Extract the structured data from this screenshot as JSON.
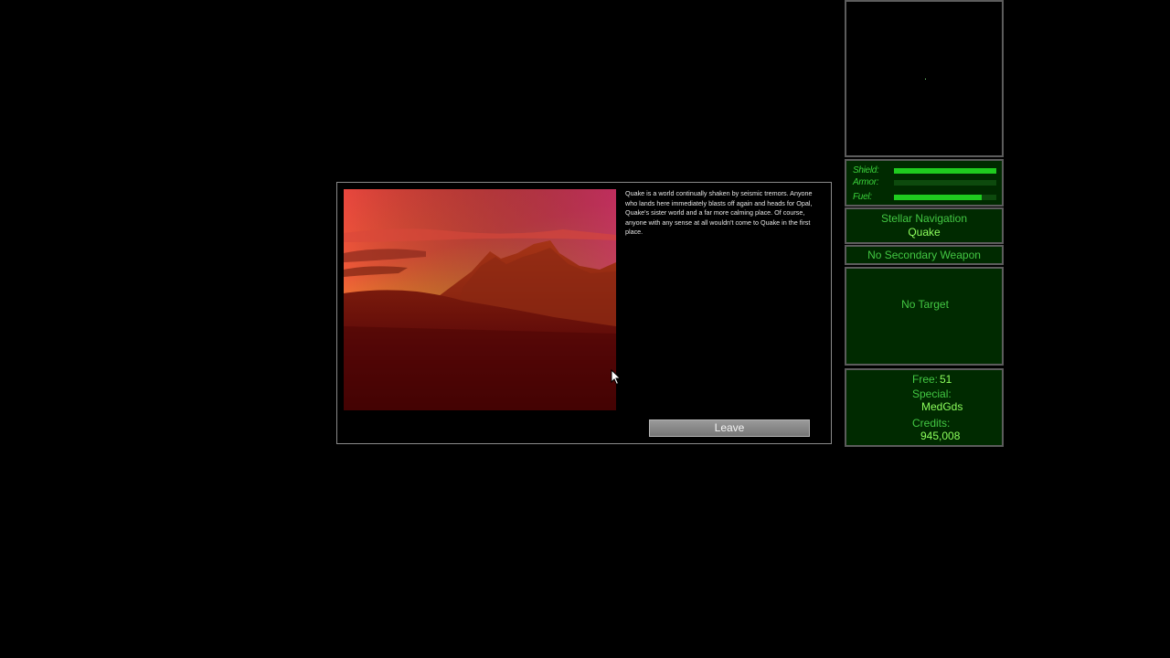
{
  "dialog": {
    "planet_description": "Quake is a world continually shaken by seismic tremors. Anyone who lands here immediately blasts off again and heads for Opal, Quake's sister world and a far more calming place. Of course, anyone with any sense at all wouldn't come to Quake in the first place.",
    "leave_label": "Leave"
  },
  "hud": {
    "status": {
      "shield_label": "Shield:",
      "armor_label": "Armor:",
      "fuel_label": "Fuel:",
      "shield_level": 1.0,
      "armor_level": 0.0,
      "fuel_level": 0.86
    },
    "navigation": {
      "title": "Stellar Navigation",
      "destination": "Quake"
    },
    "secondary_weapon": "No Secondary Weapon",
    "target": "No Target",
    "cargo": {
      "free_label": "Free:",
      "free_value": "51",
      "special_label": "Special:",
      "special_value": "MedGds",
      "credits_label": "Credits:",
      "credits_value": "945,008"
    }
  },
  "colors": {
    "hud_text": "#42c742",
    "hud_value": "#8cff5c",
    "hud_panel_bg": "#002a00",
    "bar_fill": "#1fcc1f"
  }
}
